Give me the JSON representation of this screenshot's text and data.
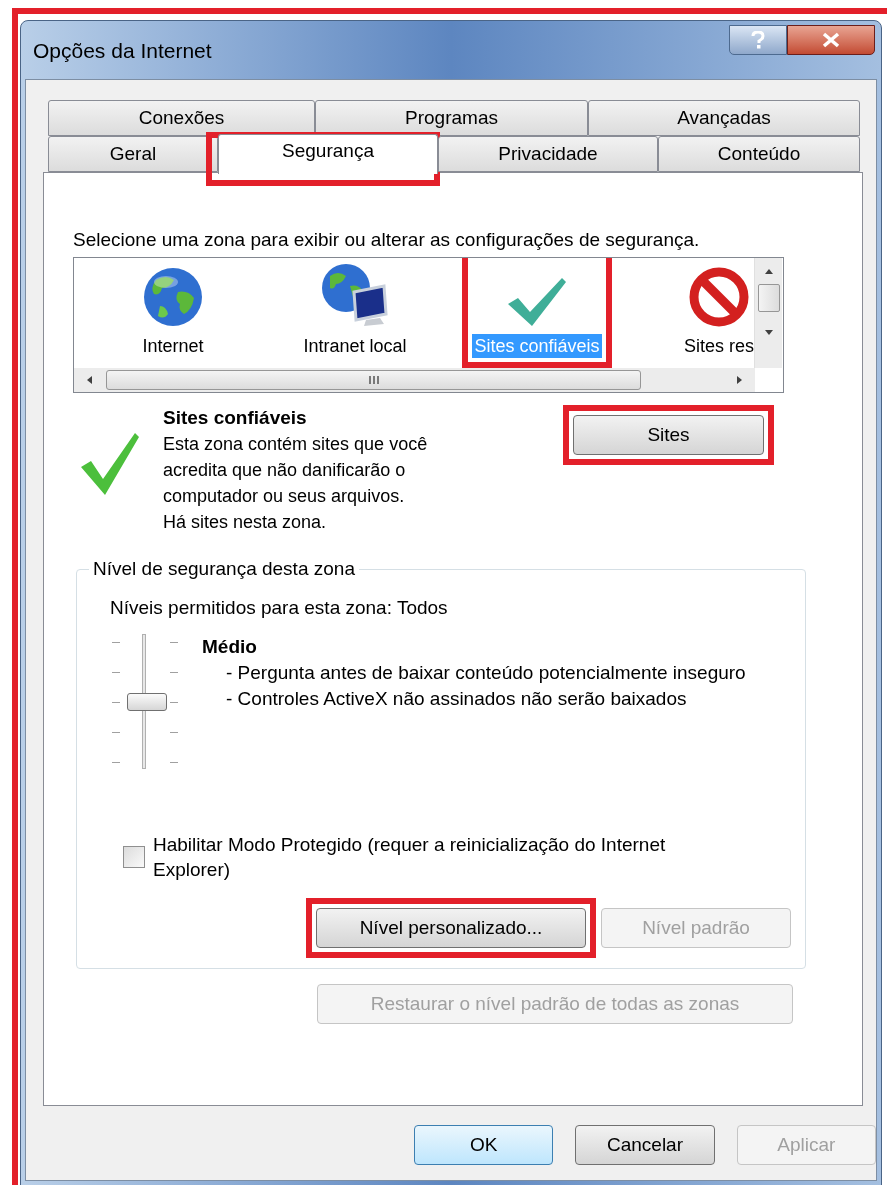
{
  "window": {
    "title": "Opções da Internet"
  },
  "tab_rows": [
    {
      "tabs": [
        {
          "label": "Conexões",
          "selected": false,
          "highlighted": false
        },
        {
          "label": "Programas",
          "selected": false,
          "highlighted": false
        },
        {
          "label": "Avançadas",
          "selected": false,
          "highlighted": false
        }
      ]
    },
    {
      "tabs": [
        {
          "label": "Geral",
          "selected": false,
          "highlighted": false
        },
        {
          "label": "Segurança",
          "selected": true,
          "highlighted": true
        },
        {
          "label": "Privacidade",
          "selected": false,
          "highlighted": false
        },
        {
          "label": "Conteúdo",
          "selected": false,
          "highlighted": false
        }
      ]
    }
  ],
  "zone_prompt": "Selecione uma zona para exibir ou alterar as configurações de segurança.",
  "zones": [
    {
      "kind": "globe",
      "label": "Internet",
      "selected": false,
      "highlighted": false
    },
    {
      "kind": "intranet",
      "label": "Intranet local",
      "selected": false,
      "highlighted": false
    },
    {
      "kind": "trusted",
      "label": "Sites confiáveis",
      "selected": true,
      "highlighted": true
    },
    {
      "kind": "restricted",
      "label": "Sites res",
      "selected": false,
      "highlighted": false
    }
  ],
  "zone_info": {
    "title": "Sites confiáveis",
    "description": [
      "Esta zona contém sites que você",
      "acredita que não danificarão o",
      "computador ou seus arquivos.",
      "Há sites nesta zona."
    ],
    "button": {
      "label": "Sites",
      "highlighted": true
    }
  },
  "security_level": {
    "legend": "Nível de segurança desta zona",
    "allowed": "Níveis permitidos para esta zona: Todos",
    "level": 0.5,
    "name": "Médio",
    "bullets": [
      "- Pergunta antes de baixar conteúdo potencialmente inseguro",
      "- Controles ActiveX não assinados não serão baixados"
    ],
    "protected_mode": {
      "label": "Habilitar Modo Protegido (requer a reinicialização do Internet Explorer)",
      "checked": false
    },
    "buttons": [
      {
        "label": "Nível personalizado...",
        "disabled": false,
        "highlighted": true
      },
      {
        "label": "Nível padrão",
        "disabled": true,
        "highlighted": false
      }
    ]
  },
  "reset_button": {
    "label": "Restaurar o nível padrão de todas as zonas",
    "disabled": true
  },
  "dialog_buttons": [
    {
      "label": "OK",
      "disabled": false,
      "default": true
    },
    {
      "label": "Cancelar",
      "disabled": false,
      "default": false
    },
    {
      "label": "Aplicar",
      "disabled": true,
      "default": false
    }
  ]
}
